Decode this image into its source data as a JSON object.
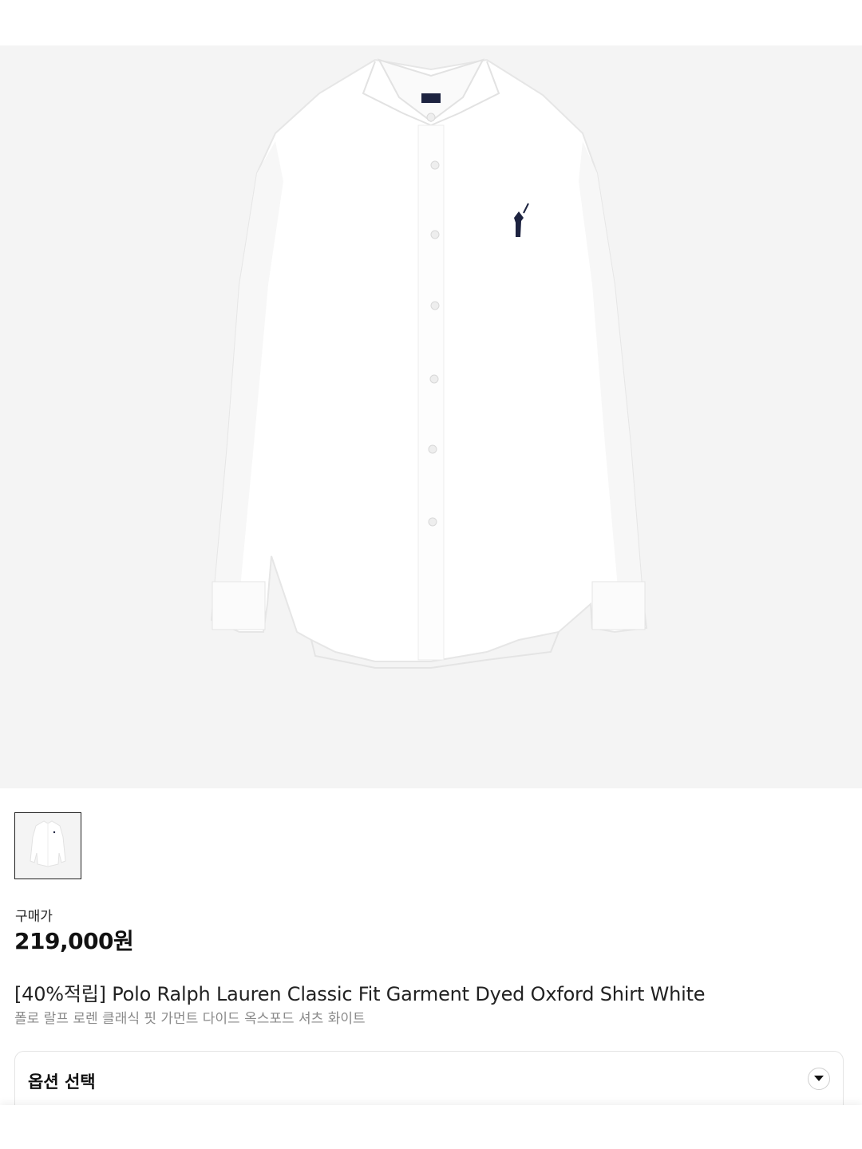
{
  "product": {
    "image_alt": "white oxford shirt",
    "thumbnail_alt": "white oxford shirt thumbnail",
    "price_label": "구매가",
    "price": "219,000원",
    "title": "[40%적립] Polo Ralph Lauren Classic Fit Garment Dyed Oxford Shirt White",
    "subtitle": "폴로 랄프 로렌 클래식 핏 가먼트 다이드 옥스포드 셔츠 화이트"
  },
  "options": {
    "label": "옵션 선택",
    "icon": "chevron-down-icon"
  },
  "colors": {
    "hero_bg": "#f4f4f4",
    "logo_navy": "#1d2340"
  }
}
